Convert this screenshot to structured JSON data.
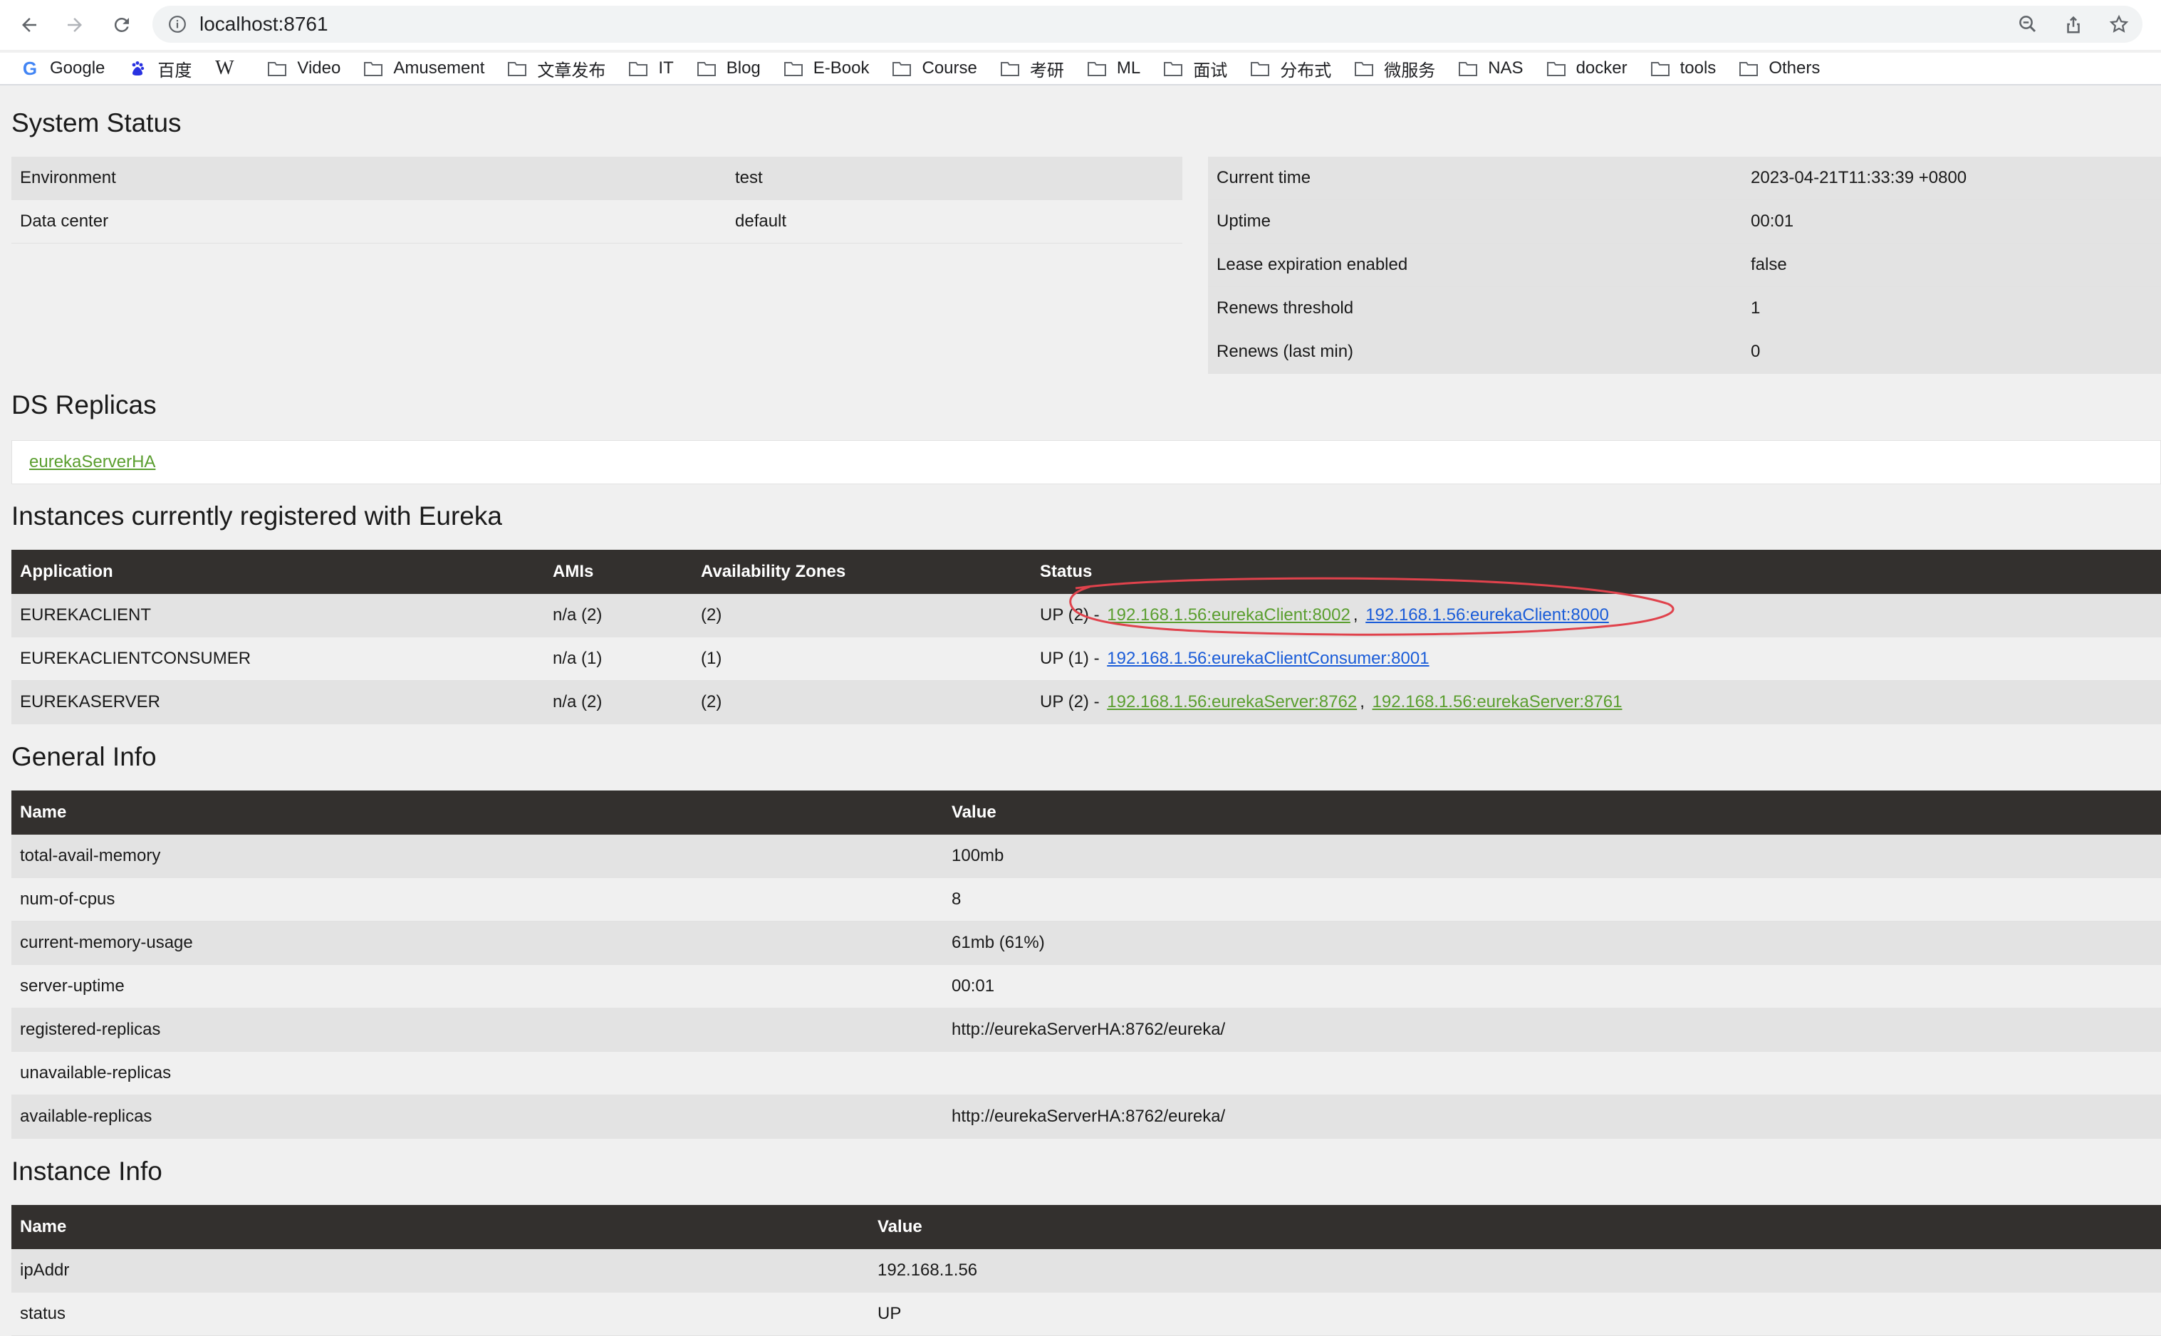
{
  "browser": {
    "url": "localhost:8761",
    "bookmarks": [
      "Google",
      "百度",
      "W",
      "Video",
      "Amusement",
      "文章发布",
      "IT",
      "Blog",
      "E-Book",
      "Course",
      "考研",
      "ML",
      "面试",
      "分布式",
      "微服务",
      "NAS",
      "docker",
      "tools",
      "Others"
    ]
  },
  "system_status": {
    "title": "System Status",
    "left": [
      {
        "key": "Environment",
        "value": "test"
      },
      {
        "key": "Data center",
        "value": "default"
      }
    ],
    "right": [
      {
        "key": "Current time",
        "value": "2023-04-21T11:33:39 +0800"
      },
      {
        "key": "Uptime",
        "value": "00:01"
      },
      {
        "key": "Lease expiration enabled",
        "value": "false"
      },
      {
        "key": "Renews threshold",
        "value": "1"
      },
      {
        "key": "Renews (last min)",
        "value": "0"
      }
    ]
  },
  "ds_replicas": {
    "title": "DS Replicas",
    "replica": "eurekaServerHA"
  },
  "instances": {
    "title": "Instances currently registered with Eureka",
    "headers": [
      "Application",
      "AMIs",
      "Availability Zones",
      "Status"
    ],
    "rows": [
      {
        "app": "EUREKACLIENT",
        "amis": "n/a (2)",
        "zones": "(2)",
        "status_prefix": "UP (2) -",
        "link1": "192.168.1.56:eurekaClient:8002",
        "sep": ",",
        "link2": "192.168.1.56:eurekaClient:8000"
      },
      {
        "app": "EUREKACLIENTCONSUMER",
        "amis": "n/a (1)",
        "zones": "(1)",
        "status_prefix": "UP (1) -",
        "link1": "192.168.1.56:eurekaClientConsumer:8001"
      },
      {
        "app": "EUREKASERVER",
        "amis": "n/a (2)",
        "zones": "(2)",
        "status_prefix": "UP (2) -",
        "link1": "192.168.1.56:eurekaServer:8762",
        "sep": ",",
        "link2": "192.168.1.56:eurekaServer:8761"
      }
    ]
  },
  "general_info": {
    "title": "General Info",
    "headers": [
      "Name",
      "Value"
    ],
    "rows": [
      {
        "name": "total-avail-memory",
        "value": "100mb"
      },
      {
        "name": "num-of-cpus",
        "value": "8"
      },
      {
        "name": "current-memory-usage",
        "value": "61mb (61%)"
      },
      {
        "name": "server-uptime",
        "value": "00:01"
      },
      {
        "name": "registered-replicas",
        "value": "http://eurekaServerHA:8762/eureka/"
      },
      {
        "name": "unavailable-replicas",
        "value": ""
      },
      {
        "name": "available-replicas",
        "value": "http://eurekaServerHA:8762/eureka/"
      }
    ]
  },
  "instance_info": {
    "title": "Instance Info",
    "headers": [
      "Name",
      "Value"
    ],
    "rows": [
      {
        "name": "ipAddr",
        "value": "192.168.1.56"
      },
      {
        "name": "status",
        "value": "UP"
      }
    ]
  },
  "colors": {
    "header_dark": "#33302e",
    "link_green": "#5a9e2f",
    "link_blue": "#1a5cd8",
    "annotation_red": "#e0424c"
  }
}
